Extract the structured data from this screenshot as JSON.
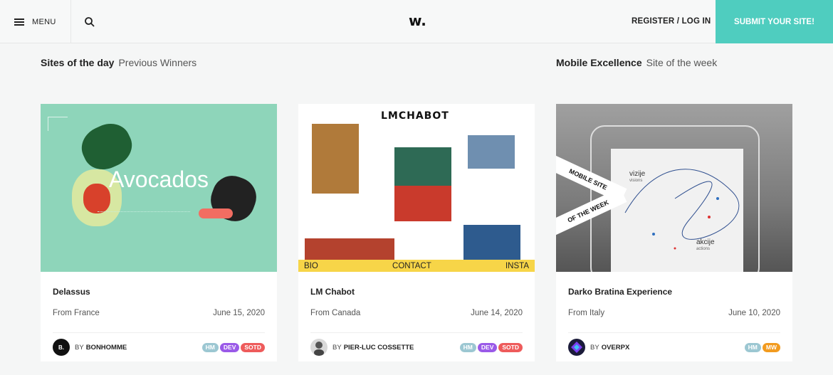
{
  "header": {
    "menu_label": "MENU",
    "logo": "w.",
    "register_label": "REGISTER / LOG IN",
    "submit_label": "SUBMIT YOUR SITE!",
    "submit_color": "#4fcdbf",
    "icons": {
      "menu": "hamburger-icon",
      "search": "search-icon"
    }
  },
  "sections": [
    {
      "title": "Sites of the day",
      "link": "Previous Winners"
    },
    {
      "title": "Mobile Excellence",
      "link": "Site of the week"
    }
  ],
  "cards": [
    {
      "thumb_text": "Avocados",
      "name": "Delassus",
      "from": "From France",
      "date": "June 15, 2020",
      "by_label": "BY",
      "author": "BONHOMME",
      "avatar_text": "B.",
      "badges": [
        "HM",
        "DEV",
        "SOTD"
      ]
    },
    {
      "brand": "LMCHABOT",
      "bar": [
        "BIO",
        "CONTACT",
        "INSTA"
      ],
      "name": "LM Chabot",
      "from": "From Canada",
      "date": "June 14, 2020",
      "by_label": "BY",
      "author": "PIER-LUC COSSETTE",
      "badges": [
        "HM",
        "DEV",
        "SOTD"
      ]
    },
    {
      "ribbon_top": "MOBILE SITE",
      "ribbon_bottom": "OF THE WEEK",
      "screen_title": "vizije",
      "screen_sub": "visions",
      "screen_word": "akcije",
      "screen_word_sub": "actions",
      "name": "Darko Bratina Experience",
      "from": "From Italy",
      "date": "June 10, 2020",
      "by_label": "BY",
      "author": "OVERPX",
      "badges": [
        "HM",
        "MW"
      ]
    }
  ]
}
